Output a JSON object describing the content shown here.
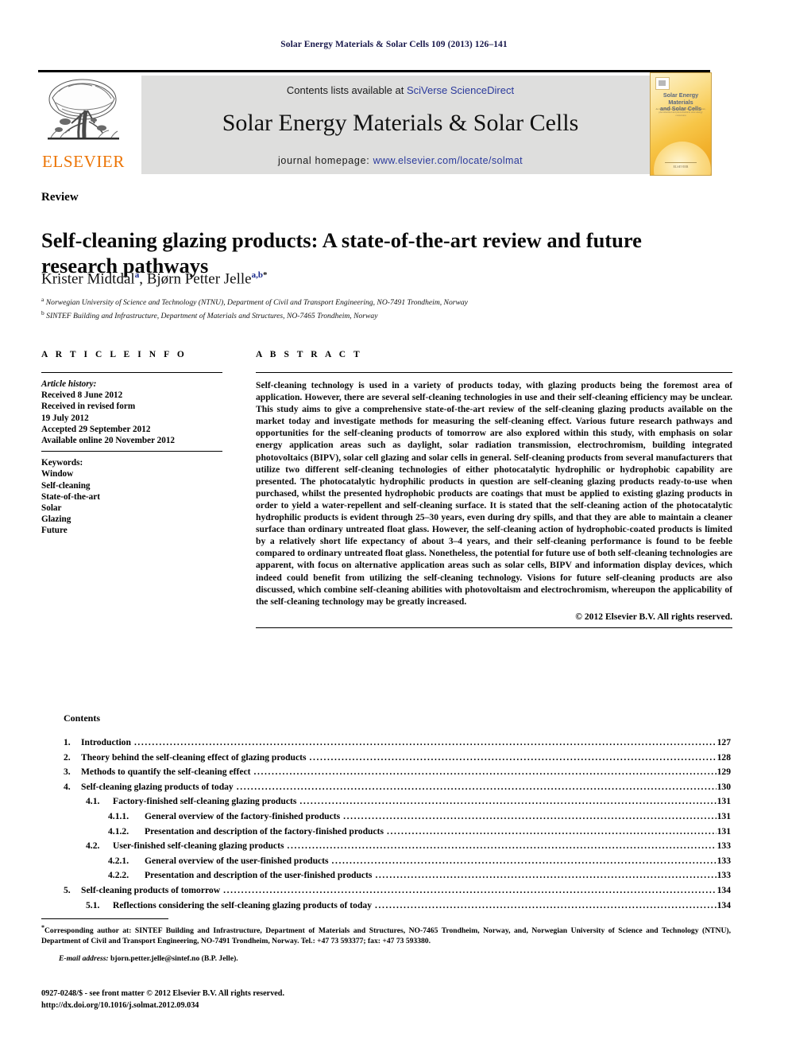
{
  "running_head": "Solar Energy Materials & Solar Cells 109 (2013) 126–141",
  "masthead": {
    "publisher_name": "ELSEVIER",
    "contents_prefix": "Contents lists available at",
    "contents_link": "SciVerse ScienceDirect",
    "journal_title": "Solar Energy Materials & Solar Cells",
    "homepage_prefix": "journal homepage:",
    "homepage_link": "www.elsevier.com/locate/solmat",
    "cover": {
      "title_line1": "Solar Energy Materials",
      "title_line2": "and Solar Cells",
      "subtitle": "An interdisciplinary journal devoted to photovoltaic, photothermal and photochemical solar energy conversion",
      "footer": "ELSEVIER"
    }
  },
  "article": {
    "doctype": "Review",
    "title": "Self-cleaning glazing products: A state-of-the-art review and future research pathways",
    "authors": [
      {
        "name": "Krister Midtdal",
        "marks": "a"
      },
      {
        "name": "Bjørn Petter Jelle",
        "marks": "a,b"
      }
    ],
    "authors_separator": ", ",
    "corresponding_mark": "*",
    "affiliations": [
      {
        "mark": "a",
        "text": "Norwegian University of Science and Technology (NTNU), Department of Civil and Transport Engineering, NO-7491 Trondheim, Norway"
      },
      {
        "mark": "b",
        "text": "SINTEF Building and Infrastructure, Department of Materials and Structures, NO-7465 Trondheim, Norway"
      }
    ]
  },
  "article_info": {
    "heading": "A R T I C L E   I N F O",
    "history_label": "Article history:",
    "history": [
      "Received 8 June 2012",
      "Received in revised form",
      "19 July 2012",
      "Accepted 29 September 2012",
      "Available online 20 November 2012"
    ],
    "keywords_label": "Keywords:",
    "keywords": [
      "Window",
      "Self-cleaning",
      "State-of-the-art",
      "Solar",
      "Glazing",
      "Future"
    ]
  },
  "abstract": {
    "heading": "A B S T R A C T",
    "text": "Self-cleaning technology is used in a variety of products today, with glazing products being the foremost area of application. However, there are several self-cleaning technologies in use and their self-cleaning efficiency may be unclear. This study aims to give a comprehensive state-of-the-art review of the self-cleaning glazing products available on the market today and investigate methods for measuring the self-cleaning effect. Various future research pathways and opportunities for the self-cleaning products of tomorrow are also explored within this study, with emphasis on solar energy application areas such as daylight, solar radiation transmission, electrochromism, building integrated photovoltaics (BIPV), solar cell glazing and solar cells in general. Self-cleaning products from several manufacturers that utilize two different self-cleaning technologies of either photocatalytic hydrophilic or hydrophobic capability are presented. The photocatalytic hydrophilic products in question are self-cleaning glazing products ready-to-use when purchased, whilst the presented hydrophobic products are coatings that must be applied to existing glazing products in order to yield a water-repellent and self-cleaning surface. It is stated that the self-cleaning action of the photocatalytic hydrophilic products is evident through 25–30 years, even during dry spills, and that they are able to maintain a cleaner surface than ordinary untreated float glass. However, the self-cleaning action of hydrophobic-coated products is limited by a relatively short life expectancy of about 3–4 years, and their self-cleaning performance is found to be feeble compared to ordinary untreated float glass. Nonetheless, the potential for future use of both self-cleaning technologies are apparent, with focus on alternative application areas such as solar cells, BIPV and information display devices, which indeed could benefit from utilizing the self-cleaning technology. Visions for future self-cleaning products are also discussed, which combine self-cleaning abilities with photovoltaism and electrochromism, whereupon the applicability of the self-cleaning technology may be greatly increased.",
    "copyright": "© 2012 Elsevier B.V. All rights reserved."
  },
  "contents": {
    "heading": "Contents",
    "entries": [
      {
        "level": 1,
        "number": "1.",
        "label": "Introduction",
        "page": "127"
      },
      {
        "level": 1,
        "number": "2.",
        "label": "Theory behind the self-cleaning effect of glazing products",
        "page": "128"
      },
      {
        "level": 1,
        "number": "3.",
        "label": "Methods to quantify the self-cleaning effect",
        "page": "129"
      },
      {
        "level": 1,
        "number": "4.",
        "label": "Self-cleaning glazing products of today",
        "page": "130"
      },
      {
        "level": 2,
        "number": "4.1.",
        "label": "Factory-finished self-cleaning glazing products",
        "page": "131"
      },
      {
        "level": 3,
        "number": "4.1.1.",
        "label": "General overview of the factory-finished products",
        "page": "131"
      },
      {
        "level": 3,
        "number": "4.1.2.",
        "label": "Presentation and description of the factory-finished products",
        "page": "131"
      },
      {
        "level": 2,
        "number": "4.2.",
        "label": "User-finished self-cleaning glazing products",
        "page": "133"
      },
      {
        "level": 3,
        "number": "4.2.1.",
        "label": "General overview of the user-finished products",
        "page": "133"
      },
      {
        "level": 3,
        "number": "4.2.2.",
        "label": "Presentation and description of the user-finished products",
        "page": "133"
      },
      {
        "level": 1,
        "number": "5.",
        "label": "Self-cleaning products of tomorrow",
        "page": "134"
      },
      {
        "level": 2,
        "number": "5.1.",
        "label": "Reflections considering the self-cleaning glazing products of today",
        "page": "134"
      }
    ]
  },
  "footer": {
    "corresponding_mark": "*",
    "corresponding_text": "Corresponding author at: SINTEF Building and Infrastructure, Department of Materials and Structures, NO-7465 Trondheim, Norway, and, Norwegian University of Science and Technology (NTNU), Department of Civil and Transport Engineering, NO-7491 Trondheim, Norway. Tel.: +47 73 593377; fax: +47 73 593380.",
    "email_label": "E-mail address:",
    "email_value": "bjorn.petter.jelle@sintef.no (B.P. Jelle).",
    "issn_line": "0927-0248/$ - see front matter © 2012 Elsevier B.V. All rights reserved.",
    "doi_line": "http://dx.doi.org/10.1016/j.solmat.2012.09.034"
  }
}
